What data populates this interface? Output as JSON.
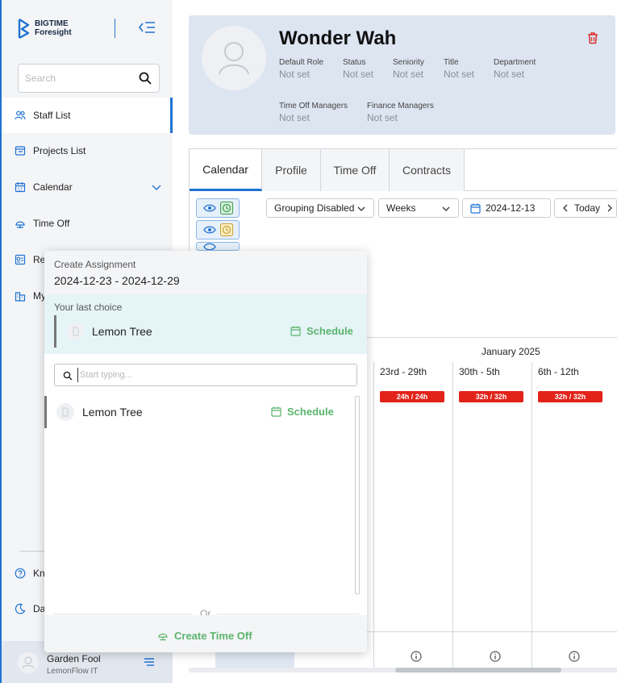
{
  "brand": {
    "line1": "BIGTIME",
    "line2": "Foresight",
    "color": "#1f73d1"
  },
  "search": {
    "placeholder": "Search"
  },
  "sidebar": {
    "items": [
      {
        "label": "Staff List",
        "icon": "users-icon"
      },
      {
        "label": "Projects List",
        "icon": "projects-icon"
      },
      {
        "label": "Calendar",
        "icon": "calendar-icon"
      },
      {
        "label": "Time Off",
        "icon": "timeoff-icon"
      },
      {
        "label": "Re",
        "icon": "reports-icon"
      },
      {
        "label": "My",
        "icon": "company-icon"
      }
    ],
    "bottom_items": [
      {
        "label": "Kn",
        "icon": "help-icon"
      },
      {
        "label": "Da",
        "icon": "moon-icon"
      }
    ]
  },
  "user": {
    "name": "Garden Fool",
    "org": "LemonFlow IT"
  },
  "profile": {
    "name": "Wonder Wah",
    "fields": [
      {
        "label": "Default Role",
        "value": "Not set"
      },
      {
        "label": "Status",
        "value": "Not set"
      },
      {
        "label": "Seniority",
        "value": "Not set"
      },
      {
        "label": "Title",
        "value": "Not set"
      },
      {
        "label": "Department",
        "value": "Not set"
      },
      {
        "label": "Time Off Managers",
        "value": "Not set"
      },
      {
        "label": "Finance Managers",
        "value": "Not set"
      }
    ]
  },
  "tabs": [
    "Calendar",
    "Profile",
    "Time Off",
    "Contracts"
  ],
  "toolbar": {
    "grouping": "Grouping Disabled",
    "period": "Weeks",
    "date": "2024-12-13",
    "today": "Today"
  },
  "calendar": {
    "month": "January 2025",
    "weeks": [
      {
        "label": "23rd - 29th",
        "badge": "24h / 24h"
      },
      {
        "label": "30th - 5th",
        "badge": "32h / 32h"
      },
      {
        "label": "6th - 12th",
        "badge": "32h / 32h"
      }
    ]
  },
  "popup": {
    "title": "Create Assignment",
    "dates": "2024-12-23 - 2024-12-29",
    "last_choice_title": "Your last choice",
    "last_choice": {
      "name": "Lemon Tree",
      "action": "Schedule"
    },
    "search_placeholder": "Start typing...",
    "results": [
      {
        "name": "Lemon Tree",
        "action": "Schedule"
      }
    ],
    "or": "Or",
    "time_off": "Create Time Off"
  }
}
